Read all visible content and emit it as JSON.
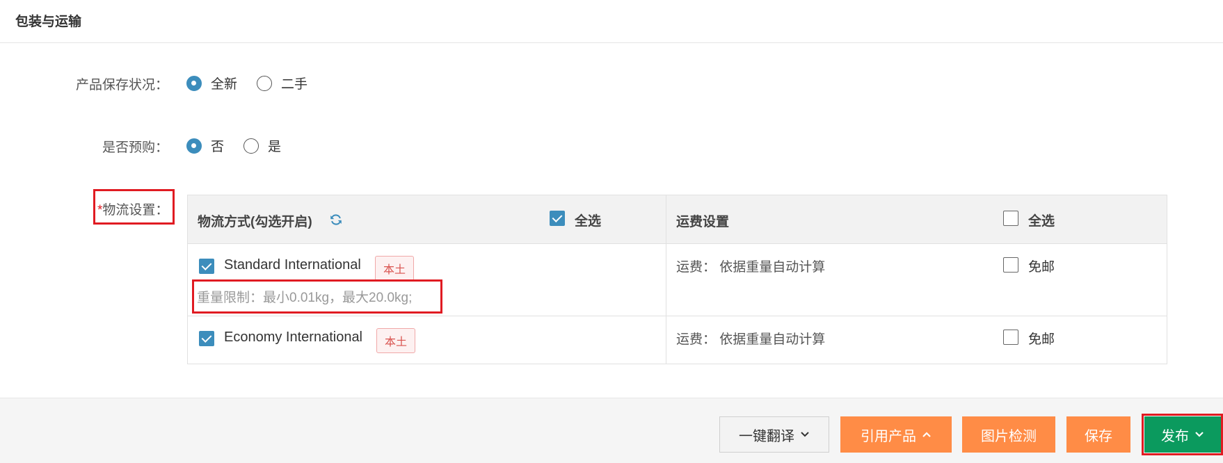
{
  "section": {
    "title": "包装与运输"
  },
  "condition": {
    "label": "产品保存状况：",
    "options": [
      {
        "label": "全新",
        "checked": true
      },
      {
        "label": "二手",
        "checked": false
      }
    ]
  },
  "presale": {
    "label": "是否预购：",
    "options": [
      {
        "label": "否",
        "checked": true
      },
      {
        "label": "是",
        "checked": false
      }
    ]
  },
  "logistics": {
    "required_mark": "*",
    "label": "物流设置：",
    "table": {
      "header_method": "物流方式(勾选开启)",
      "header_method_select_all": "全选",
      "header_method_select_all_checked": true,
      "header_fee": "运费设置",
      "header_fee_select_all": "全选",
      "header_fee_select_all_checked": false,
      "rows": [
        {
          "name": "Standard International",
          "checked": true,
          "tag": "本土",
          "weight_limit": "重量限制：最小0.01kg，最大20.0kg;",
          "fee": "运费： 依据重量自动计算",
          "free_label": "免邮",
          "free_checked": false
        },
        {
          "name": "Economy International",
          "checked": true,
          "tag": "本土",
          "fee": "运费： 依据重量自动计算",
          "free_label": "免邮",
          "free_checked": false
        }
      ]
    }
  },
  "footer": {
    "translate": "一键翻译",
    "reference": "引用产品",
    "image_check": "图片检测",
    "save": "保存",
    "publish": "发布"
  },
  "colors": {
    "accent_blue": "#3c8dbc",
    "orange": "#ff8c46",
    "green": "#0b9a5e",
    "highlight_red": "#e01b22"
  }
}
